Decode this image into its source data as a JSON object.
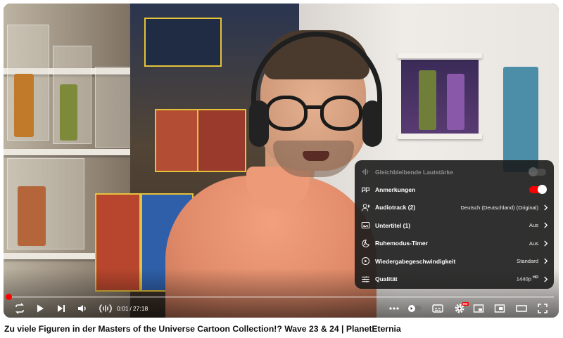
{
  "video": {
    "title": "Zu viele Figuren in der Masters of the Universe Cartoon Collection!? Wave 23 & 24 | PlanetEternia"
  },
  "settings_menu": {
    "items": [
      {
        "label": "Gleichbleibende Lautstärke",
        "icon": "stable-volume-icon",
        "control": "toggle",
        "state": "off",
        "disabled": true
      },
      {
        "label": "Anmerkungen",
        "icon": "annotations-icon",
        "control": "toggle",
        "state": "on"
      },
      {
        "label": "Audiotrack (2)",
        "icon": "audio-track-icon",
        "value": "Deutsch (Deutschland) (Original)"
      },
      {
        "label": "Untertitel (1)",
        "icon": "subtitles-icon",
        "value": "Aus"
      },
      {
        "label": "Ruhemodus-Timer",
        "icon": "sleep-timer-icon",
        "value": "Aus"
      },
      {
        "label": "Wiedergabegeschwindigkeit",
        "icon": "playback-speed-icon",
        "value": "Standard"
      },
      {
        "label": "Qualität",
        "icon": "quality-icon",
        "value": "1440p",
        "value_badge": "HD"
      }
    ]
  },
  "controls": {
    "current_time": "0:01",
    "separator": "/",
    "duration": "27:18",
    "progress": 0.001,
    "settings_badge": "HD"
  },
  "colors": {
    "accent": "#ff0000",
    "menu_bg": "#1c1c1c",
    "title_text": "#0f0f0f"
  }
}
